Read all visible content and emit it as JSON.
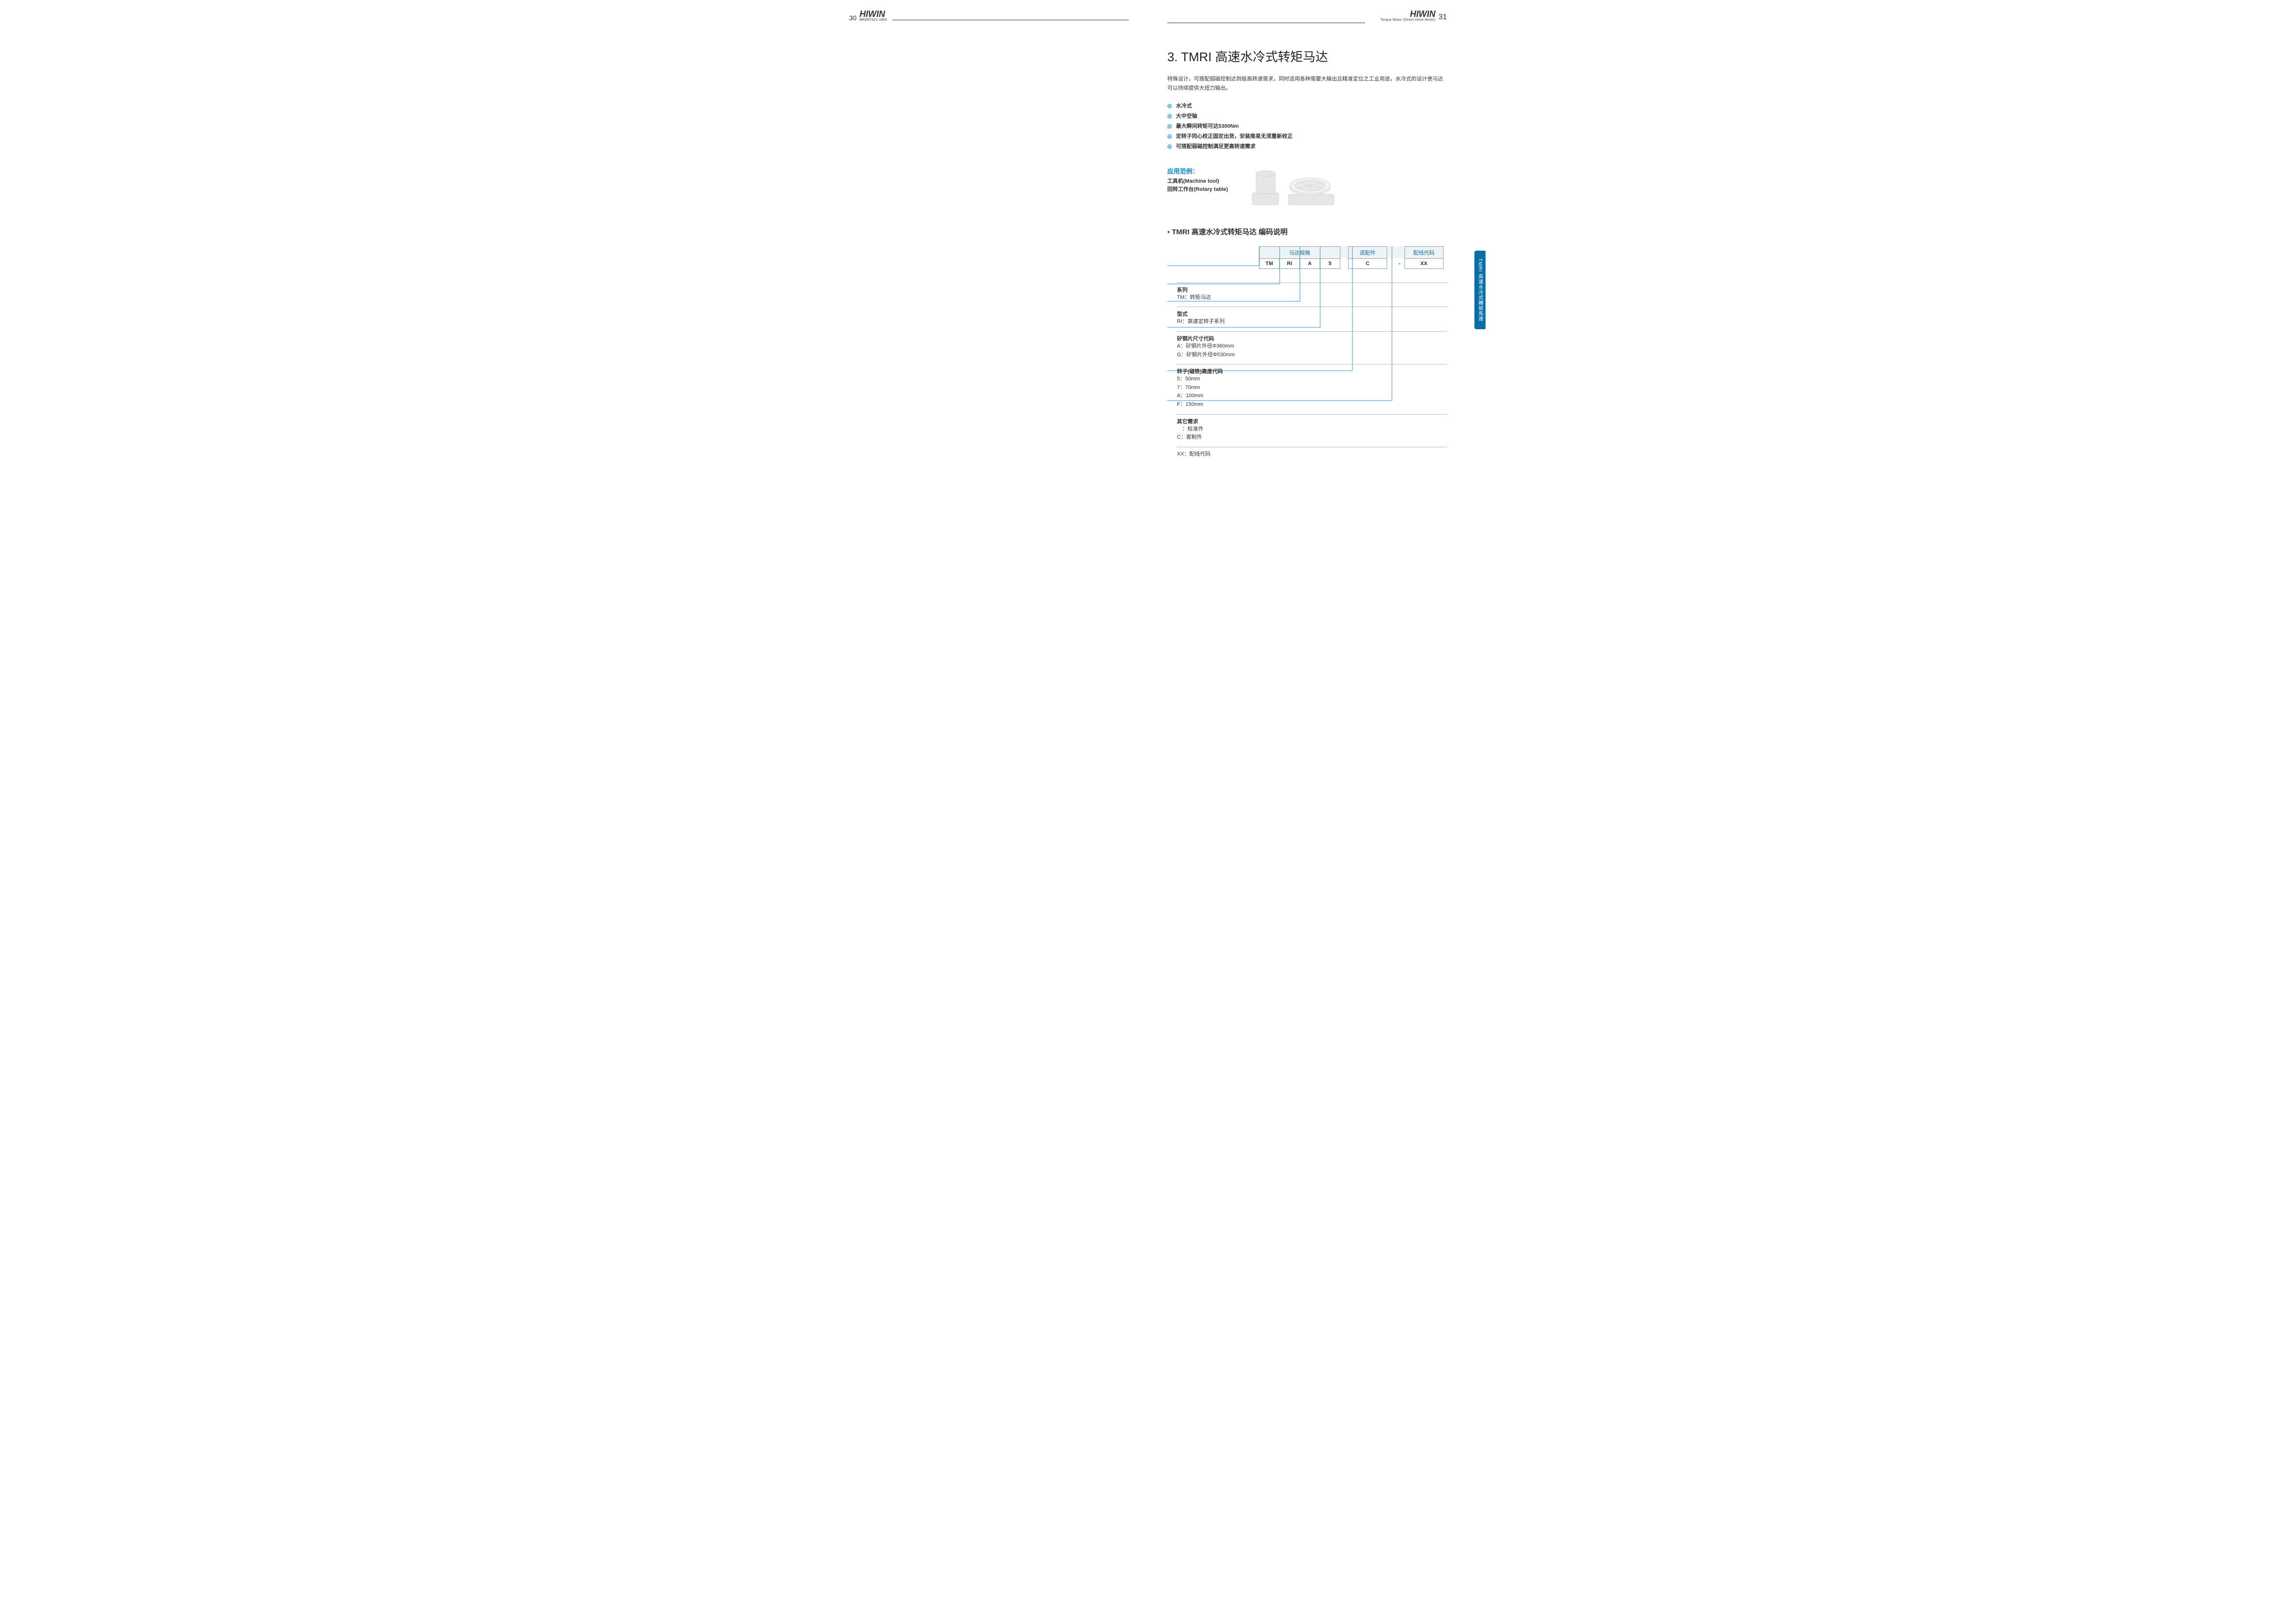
{
  "leftPage": {
    "pageNumber": "30",
    "brand": "HIWIN",
    "docCode": "MR99TS01-1800"
  },
  "rightPage": {
    "pageNumber": "31",
    "brand": "HIWIN",
    "brandSub": "Torque Motor (Direct Drive Motor)",
    "heading": "3. TMRI 高速水冷式转矩马达",
    "intro": "特殊设计，可搭配弱磁控制达到极高转速需求，同时适用各种需要大输出且精准定位之工业用途，水冷式的设计使马达可以持续提供大扭力输出。",
    "bullets": [
      "水冷式",
      "大中空轴",
      "最大瞬间转矩可达5300Nm",
      "定转子同心校正固定出货，安装简易无须重新校正",
      "可搭配弱磁控制满足更高转速需求"
    ],
    "application": {
      "label": "应用范例：",
      "items": [
        "工具机(Machine tool)",
        "回转工作台(Rotary table)"
      ]
    },
    "codeSection": {
      "title": "TMRI 高速水冷式转矩马达 编码说明",
      "headers": {
        "spec": "马达规格",
        "option": "选配件",
        "wiring": "配线代码"
      },
      "values": {
        "c1": "TM",
        "c2": "RI",
        "c3": "A",
        "c4": "5",
        "c5": "C",
        "dash": "-",
        "c6": "XX"
      },
      "explain": [
        {
          "title": "系列",
          "lines": [
            "TM：转矩马达"
          ]
        },
        {
          "title": "型式",
          "lines": [
            "RI：高速定转子系列"
          ]
        },
        {
          "title": "矽钢片尺寸代码",
          "lines": [
            "A：矽钢片外径Φ360mm",
            "G：矽钢片外径Φ530mm"
          ]
        },
        {
          "title": "转子(磁铁)高度代码",
          "lines": [
            "5：50mm",
            "7：70mm",
            "A：100mm",
            "F：150mm"
          ]
        },
        {
          "title": "其它需求",
          "lines": [
            "　：标准件",
            "C：客制件"
          ]
        },
        {
          "title": "",
          "lines": [
            "XX：配线代码"
          ]
        }
      ]
    },
    "sideTab": "TMRI 高速水冷式轉矩馬達"
  }
}
